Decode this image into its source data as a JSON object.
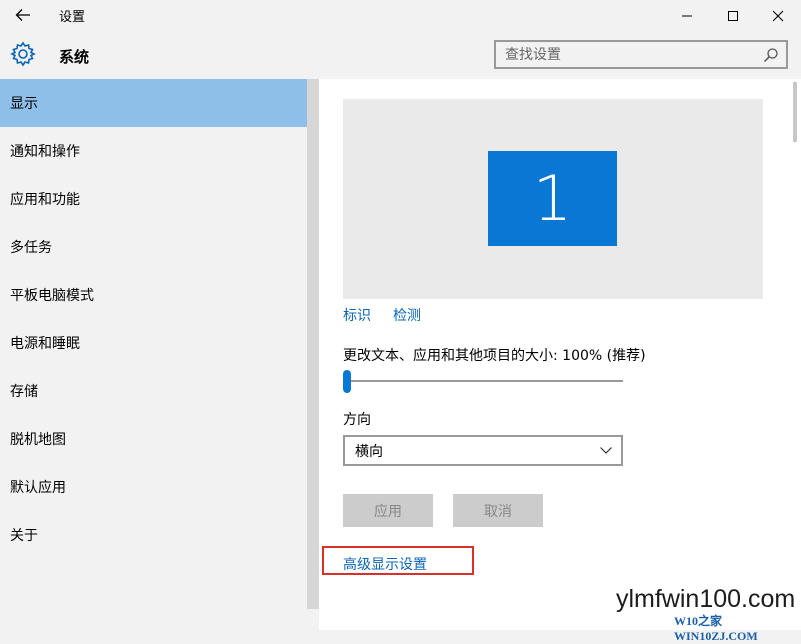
{
  "window": {
    "title": "设置",
    "controls": [
      "minimize",
      "maximize",
      "close"
    ]
  },
  "header": {
    "section_title": "系统",
    "search_placeholder": "查找设置"
  },
  "sidebar": {
    "items": [
      {
        "label": "显示",
        "active": true
      },
      {
        "label": "通知和操作",
        "active": false
      },
      {
        "label": "应用和功能",
        "active": false
      },
      {
        "label": "多任务",
        "active": false
      },
      {
        "label": "平板电脑模式",
        "active": false
      },
      {
        "label": "电源和睡眠",
        "active": false
      },
      {
        "label": "存储",
        "active": false
      },
      {
        "label": "脱机地图",
        "active": false
      },
      {
        "label": "默认应用",
        "active": false
      },
      {
        "label": "关于",
        "active": false
      }
    ]
  },
  "display": {
    "monitor_number": "1",
    "identify_link": "标识",
    "detect_link": "检测",
    "scale_label": "更改文本、应用和其他项目的大小: 100% (推荐)",
    "scale_level": 0,
    "orientation_label": "方向",
    "orientation_value": "横向",
    "apply_button": "应用",
    "cancel_button": "取消",
    "advanced_link": "高级显示设置"
  },
  "watermark": {
    "main": "ylmfwin100.com",
    "sub": "W10之家 WIN10ZJ.COM"
  },
  "colors": {
    "accent": "#0a77d5",
    "sidebar_active": "#8ebfe8",
    "link": "#0a64b4",
    "highlight_box": "#d9302a"
  },
  "icons": {
    "back": "back-arrow-icon",
    "gear": "gear-icon",
    "search": "search-icon",
    "chevron": "chevron-down-icon"
  }
}
